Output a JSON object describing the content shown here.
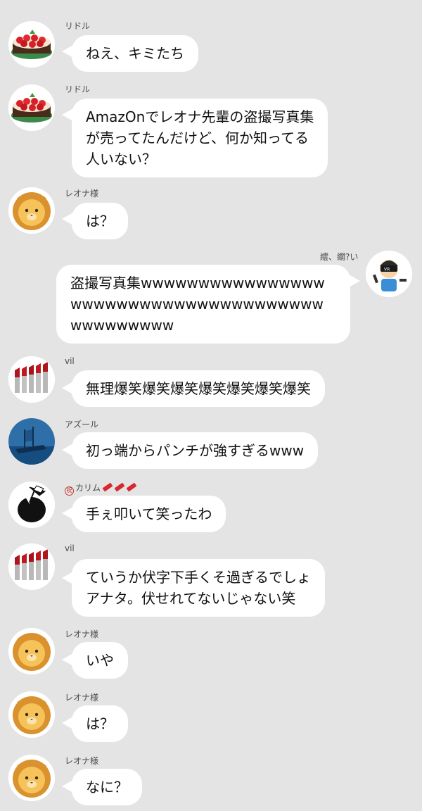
{
  "messages": [
    {
      "sender": "リドル",
      "avatar": "cake-avatar-icon",
      "lines": [
        "ねえ、キミたち"
      ]
    },
    {
      "sender": "リドル",
      "avatar": "cake-avatar-icon",
      "lines": [
        "AmazOnでレオナ先輩の盗撮写真集",
        "が売ってたんだけど、何か知ってる",
        "人いない？"
      ]
    },
    {
      "sender": "レオナ様",
      "avatar": "lion-avatar-icon",
      "lines": [
        "は？"
      ]
    },
    {
      "sender": "繧、繝?い",
      "avatar": "vr-avatar-icon",
      "lines": [
        "盗撮写真集wwwwwwwwwwwwwwww",
        "wwwwwwwwwwwwwwwwwwwwww",
        "wwwwwwwww"
      ],
      "self": true
    },
    {
      "sender": "vil",
      "avatar": "lipstick-avatar-icon",
      "lines": [
        "無理爆笑爆笑爆笑爆笑爆笑爆笑爆笑"
      ]
    },
    {
      "sender": "アズール",
      "avatar": "ship-avatar-icon",
      "lines": [
        "初っ端からパンチが強すぎるwww"
      ]
    },
    {
      "sender": "カリム",
      "sender_prefix": "祝",
      "avatar": "coconut-avatar-icon",
      "lines": [
        "手ぇ叩いて笑ったわ"
      ]
    },
    {
      "sender": "vil",
      "avatar": "lipstick-avatar-icon",
      "lines": [
        "ていうか伏字下手くそ過ぎるでしょ",
        "アナタ。伏せれてないじゃない笑"
      ]
    },
    {
      "sender": "レオナ様",
      "avatar": "lion-avatar-icon",
      "lines": [
        "いや"
      ]
    },
    {
      "sender": "レオナ様",
      "avatar": "lion-avatar-icon",
      "lines": [
        "は？"
      ]
    },
    {
      "sender": "レオナ様",
      "avatar": "lion-avatar-icon",
      "lines": [
        "なに？"
      ]
    }
  ],
  "colors": {
    "background": "#e4e4e4",
    "bubble": "#ffffff",
    "text": "#111111",
    "name": "#4a4a4a"
  }
}
